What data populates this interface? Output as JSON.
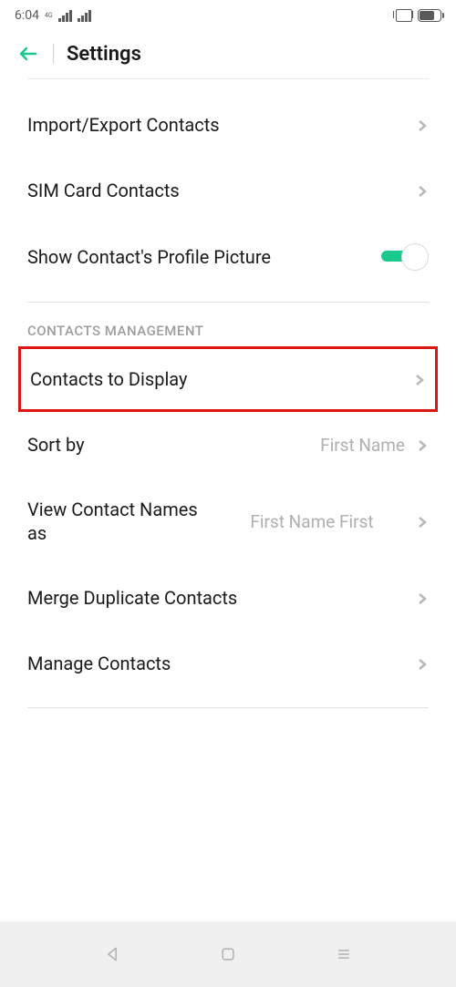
{
  "status": {
    "time": "6:04",
    "net": "4G"
  },
  "header": {
    "title": "Settings"
  },
  "rows": {
    "import_export": "Import/Export Contacts",
    "sim": "SIM Card Contacts",
    "profile_pic": "Show Contact's Profile Picture",
    "section_mgmt": "CONTACTS MANAGEMENT",
    "contacts_display": "Contacts to Display",
    "sort_by": "Sort by",
    "sort_by_val": "First Name",
    "view_names": "View Contact Names as",
    "view_names_val": "First Name First",
    "merge": "Merge Duplicate Contacts",
    "manage": "Manage Contacts"
  }
}
